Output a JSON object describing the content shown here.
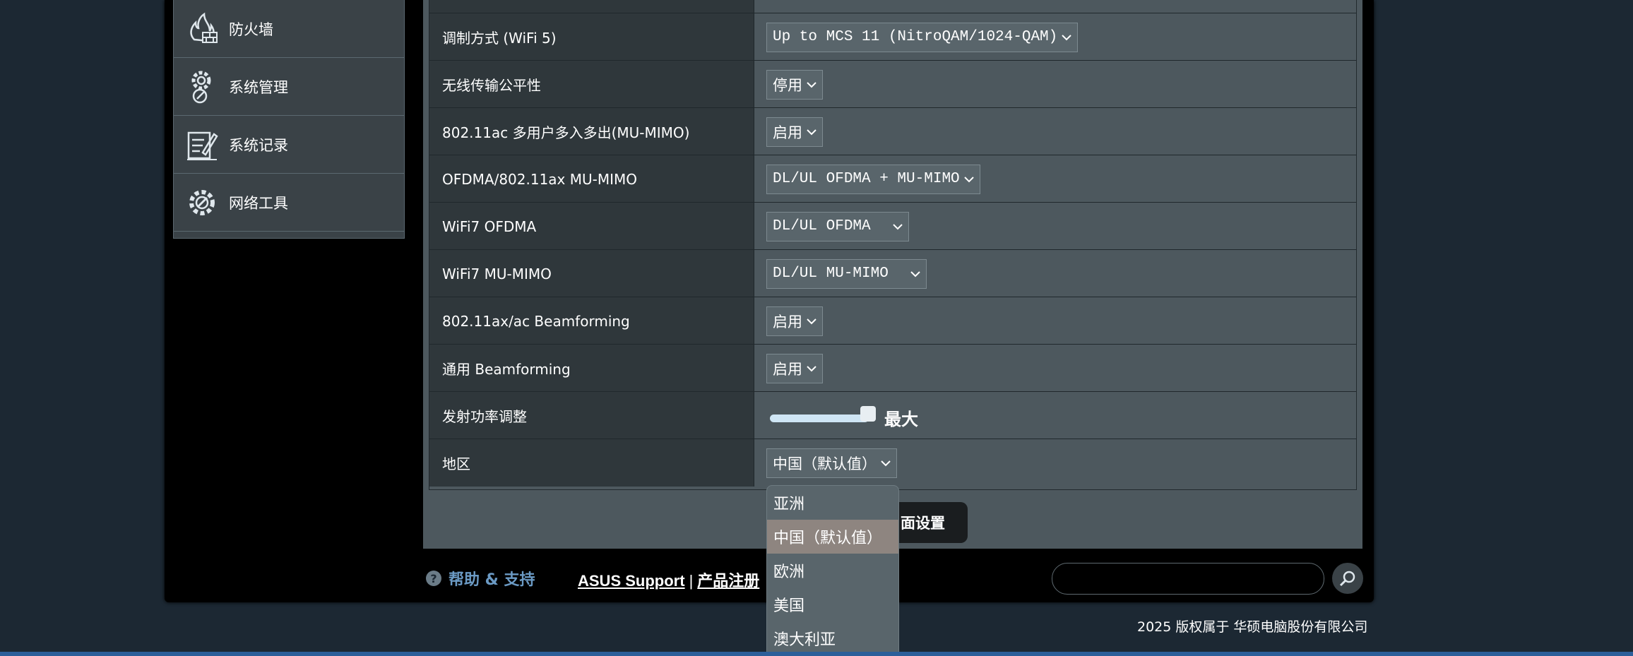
{
  "sidebar": {
    "items": [
      {
        "label": "防火墙",
        "icon": "firewall-icon"
      },
      {
        "label": "系统管理",
        "icon": "system-admin-icon"
      },
      {
        "label": "系统记录",
        "icon": "system-log-icon"
      },
      {
        "label": "网络工具",
        "icon": "network-tools-icon"
      }
    ]
  },
  "settings": {
    "rows": [
      {
        "label": "调制方式 (WiFi 5)",
        "value": "Up to MCS 11 (NitroQAM/1024-QAM)"
      },
      {
        "label": "无线传输公平性",
        "value": "停用"
      },
      {
        "label": "802.11ac 多用户多入多出(MU-MIMO)",
        "value": "启用"
      },
      {
        "label": "OFDMA/802.11ax MU-MIMO",
        "value": "DL/UL OFDMA + MU-MIMO"
      },
      {
        "label": "WiFi7 OFDMA",
        "value": "DL/UL OFDMA  "
      },
      {
        "label": "WiFi7 MU-MIMO",
        "value": "DL/UL MU-MIMO  "
      },
      {
        "label": "802.11ax/ac Beamforming",
        "value": "启用"
      },
      {
        "label": "通用 Beamforming",
        "value": "启用"
      },
      {
        "label": "发射功率调整",
        "value": "最大",
        "slider_level": 1.0
      },
      {
        "label": "地区",
        "value": "中国（默认值）"
      }
    ]
  },
  "apply_button": {
    "label": "面设置"
  },
  "region_dropdown": {
    "options": [
      "亚洲",
      "中国（默认值）",
      "欧洲",
      "美国",
      "澳大利亚"
    ],
    "selected_index": 1
  },
  "footer": {
    "help_label": "帮助 & 支持",
    "asus_support": "ASUS Support",
    "separator": "|",
    "product_registration": "产品注册",
    "copyright": "2025 版权属于 华硕电脑股份有限公司"
  },
  "colors": {
    "background": "#1c2833",
    "panel": "#4d585e",
    "label_cell": "#2f373b",
    "help_link": "#6b9ac4",
    "bottom_bar": "#2c5f9a",
    "dropdown_highlight": "#8e8580"
  }
}
